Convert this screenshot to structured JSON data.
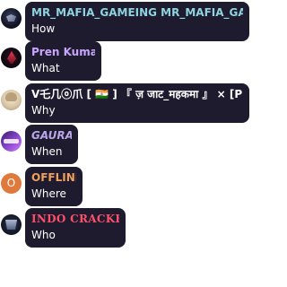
{
  "messages": [
    {
      "author": "MR_MAFIA_GAMEING MR_MAFIA_GAM...",
      "text": "How",
      "name_color": "#8fd3e0",
      "avatar": "dark-logo-avatar"
    },
    {
      "author": "Pren Kumar",
      "text": "What",
      "name_color": "#c8a6ff",
      "avatar": "red-logo-avatar"
    },
    {
      "author": "V乇几ⓞ爪 [ 🇮🇳 ] 『 ज़ जाट_महकमा 』 × [PrT...",
      "text": "Why",
      "name_color": "#ffffff",
      "avatar": "anime-avatar"
    },
    {
      "author": "GAURAV",
      "text": "When",
      "name_color": "#b8a7e8",
      "avatar": "purple-banner-avatar"
    },
    {
      "author": "OFFLINE",
      "text": "Where",
      "name_color": "#f0a05a",
      "avatar": "letter-avatar",
      "avatar_letter": "O"
    },
    {
      "author": "INDO CRACKER",
      "text": "Who",
      "name_color": "#ff4f6a",
      "avatar": "indo-logo-avatar"
    }
  ],
  "colors": {
    "bubble_background": "#1e1b2e",
    "message_text": "#ffffff",
    "page_background": "#ffffff",
    "offline_avatar": "#e07a3c"
  }
}
